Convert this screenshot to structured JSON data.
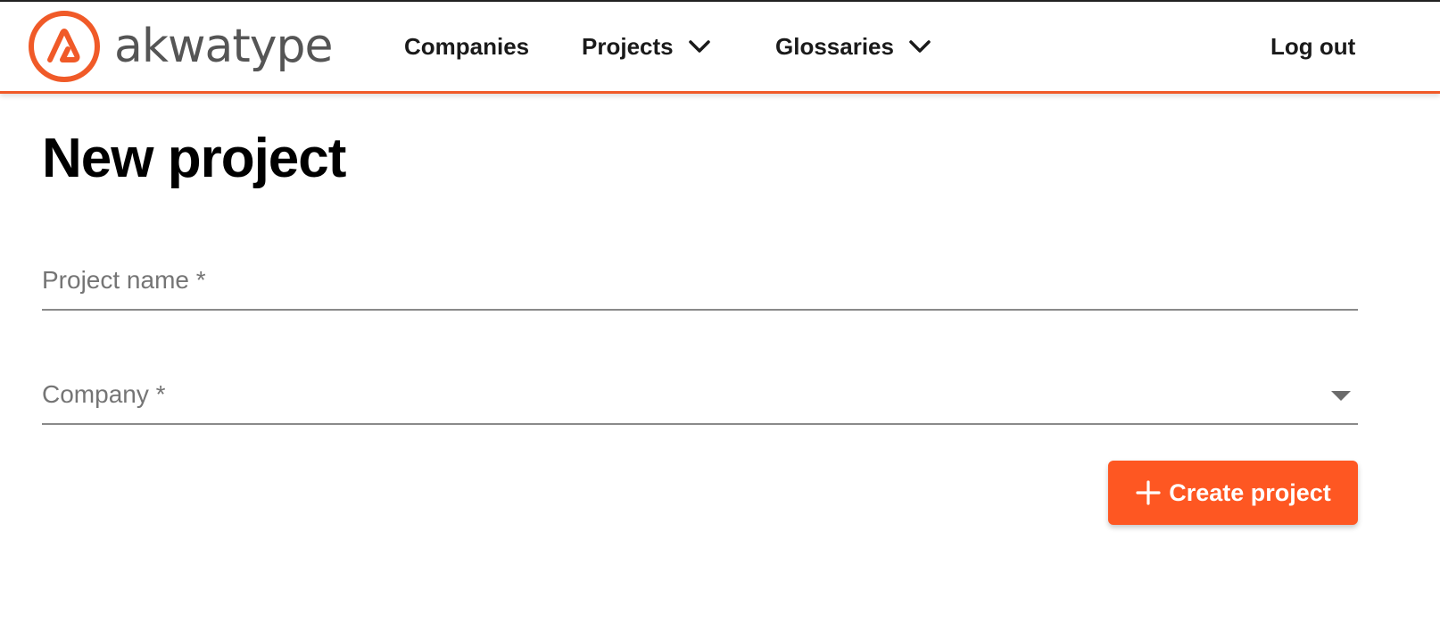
{
  "brand": {
    "name": "akwatype",
    "accent_color": "#f05a28",
    "button_color": "#fe5722"
  },
  "nav": {
    "companies": "Companies",
    "projects": "Projects",
    "glossaries": "Glossaries",
    "logout": "Log out"
  },
  "page": {
    "title": "New project"
  },
  "form": {
    "project_name_label": "Project name *",
    "project_name_value": "",
    "company_label": "Company *",
    "company_value": ""
  },
  "actions": {
    "create_label": "Create project",
    "create_icon": "plus-icon"
  }
}
